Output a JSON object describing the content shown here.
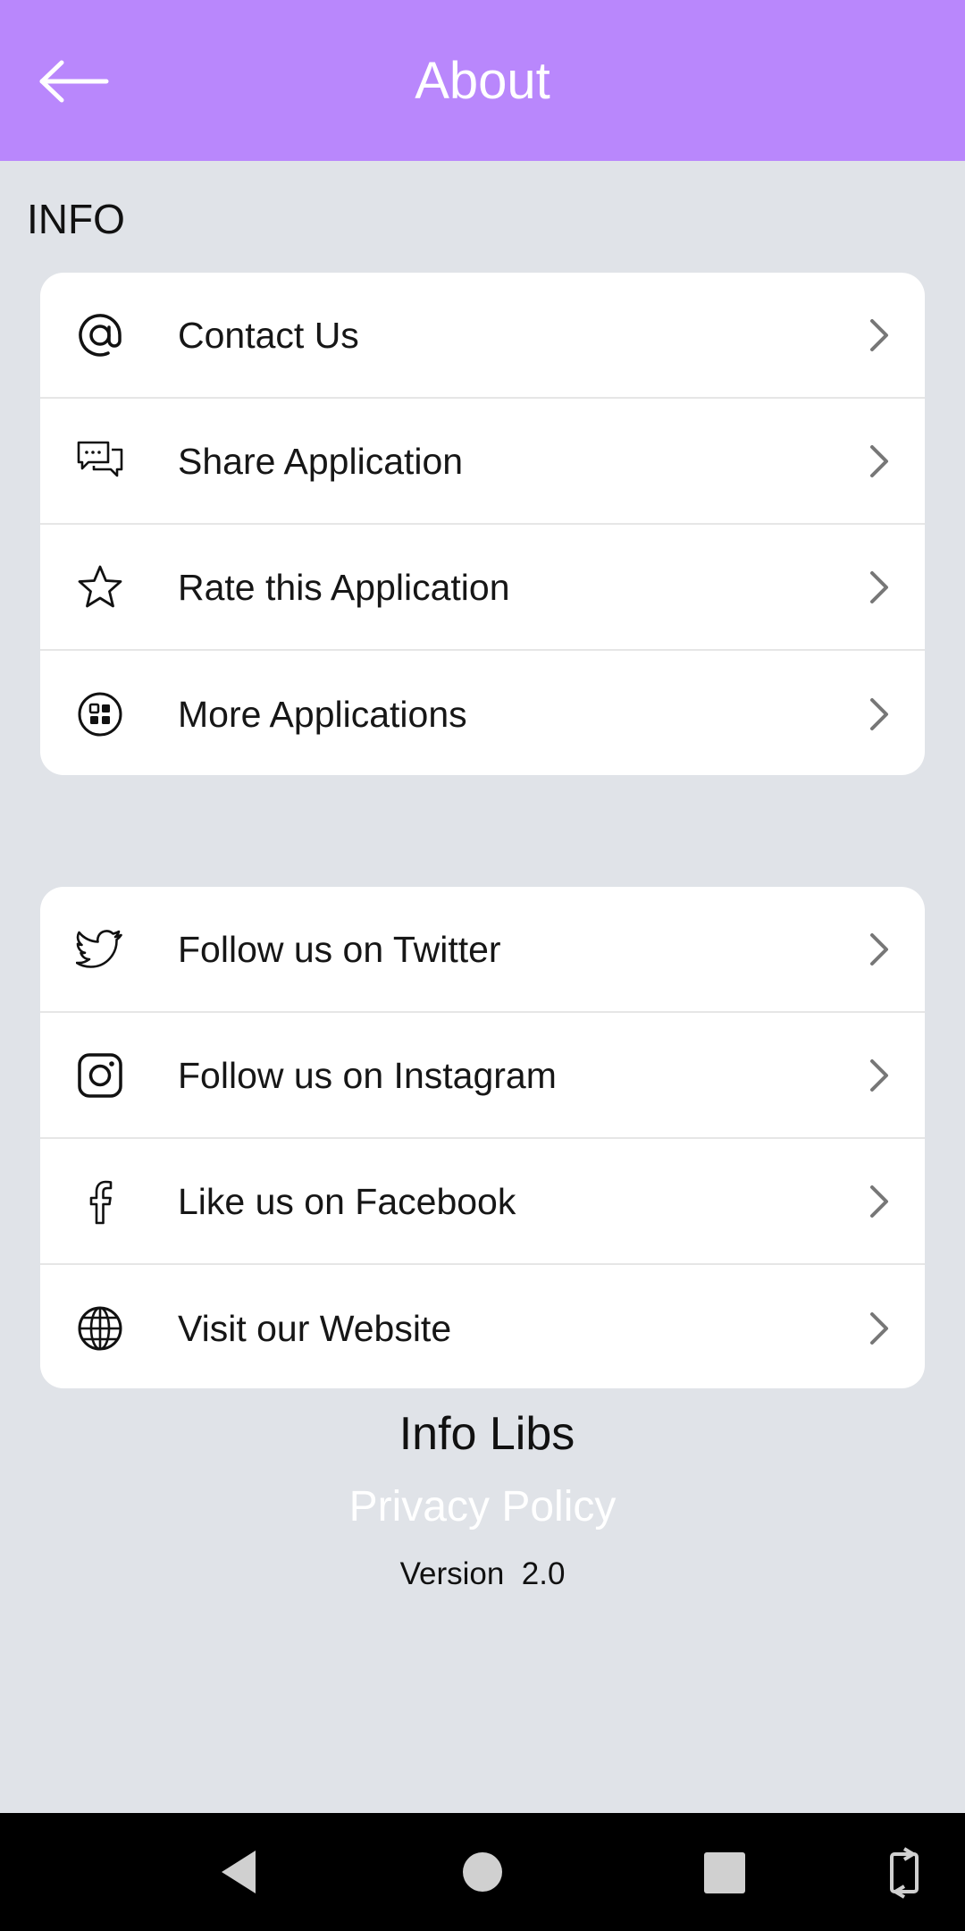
{
  "appbar": {
    "title": "About",
    "back_icon": "arrow-left-icon",
    "color": "#b987fc"
  },
  "info_section": {
    "header": "INFO"
  },
  "card_primary": {
    "items": [
      {
        "label": "Contact Us",
        "icon": "at-sign-icon"
      },
      {
        "label": "Share Application",
        "icon": "chat-bubbles-icon"
      },
      {
        "label": "Rate this Application",
        "icon": "star-icon"
      },
      {
        "label": "More Applications",
        "icon": "apps-grid-icon"
      }
    ]
  },
  "card_social": {
    "items": [
      {
        "label": "Follow us on Twitter",
        "icon": "twitter-icon"
      },
      {
        "label": "Follow us on Instagram",
        "icon": "instagram-icon"
      },
      {
        "label": "Like us on Facebook",
        "icon": "facebook-icon"
      },
      {
        "label": "Visit our Website",
        "icon": "globe-icon"
      }
    ]
  },
  "footer": {
    "company": "Info Libs",
    "privacy_link": "Privacy Policy",
    "version_label": "Version",
    "version_number": "2.0"
  },
  "system_nav": {
    "icons": [
      "nav-back-icon",
      "nav-home-icon",
      "nav-recents-icon",
      "rotate-icon"
    ]
  },
  "colors": {
    "background": "#e0e3e8",
    "card": "#ffffff",
    "accent": "#b987fc"
  }
}
